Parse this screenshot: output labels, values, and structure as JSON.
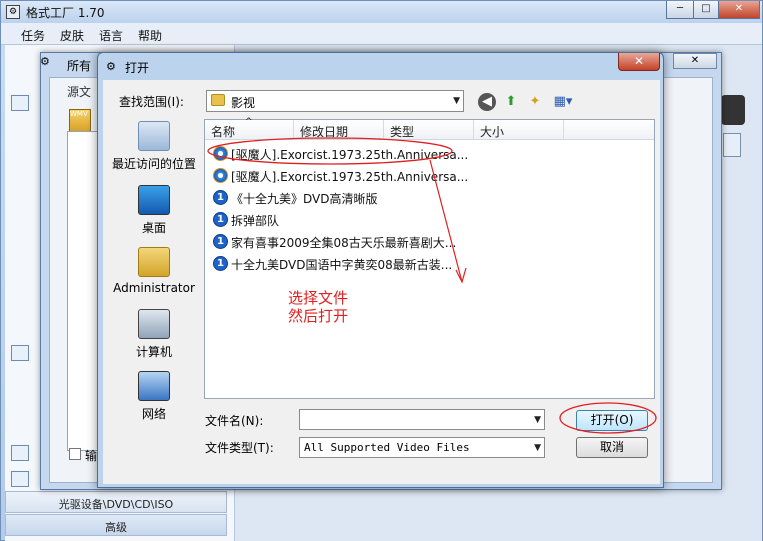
{
  "app": {
    "title": "格式工厂 1.70",
    "min": "─",
    "max": "□",
    "close": "✕",
    "menu": [
      "任务",
      "皮肤",
      "语言",
      "帮助"
    ]
  },
  "left_panel": {
    "bottom_items": [
      "光驱设备\\DVD\\CD\\ISO",
      "高级"
    ]
  },
  "inner_window": {
    "title": "所有",
    "group_label": "源文",
    "output_label": "输",
    "close": "✕"
  },
  "dialog": {
    "title": "打开",
    "close": "✕",
    "look_in_label": "查找范围(I):",
    "look_in_value": "影视",
    "places": [
      {
        "label": "最近访问的位置",
        "icon": "recent-places-icon"
      },
      {
        "label": "桌面",
        "icon": "desktop-icon"
      },
      {
        "label": "Administrator",
        "icon": "user-folder-icon"
      },
      {
        "label": "计算机",
        "icon": "computer-icon"
      },
      {
        "label": "网络",
        "icon": "network-icon"
      }
    ],
    "columns": [
      "名称",
      "修改日期",
      "类型",
      "大小"
    ],
    "files": [
      {
        "name": "[驱魔人].Exorcist.1973.25th.Anniversa...",
        "icon": "wmp-icon"
      },
      {
        "name": "[驱魔人].Exorcist.1973.25th.Anniversa...",
        "icon": "wmp-icon"
      },
      {
        "name": "《十全九美》DVD高清晰版",
        "icon": "media-file-icon"
      },
      {
        "name": "拆弹部队",
        "icon": "media-file-icon"
      },
      {
        "name": "家有喜事2009全集08古天乐最新喜剧大...",
        "icon": "media-file-icon"
      },
      {
        "name": "十全九美DVD国语中字黄奕08最新古装...",
        "icon": "media-file-icon"
      }
    ],
    "filename_label": "文件名(N):",
    "filename_value": "",
    "filetype_label": "文件类型(T):",
    "filetype_value": "All Supported Video Files",
    "open_button": "打开(O)",
    "cancel_button": "取消"
  },
  "annotation": {
    "line1": "选择文件",
    "line2": "然后打开",
    "color": "#e02020"
  }
}
